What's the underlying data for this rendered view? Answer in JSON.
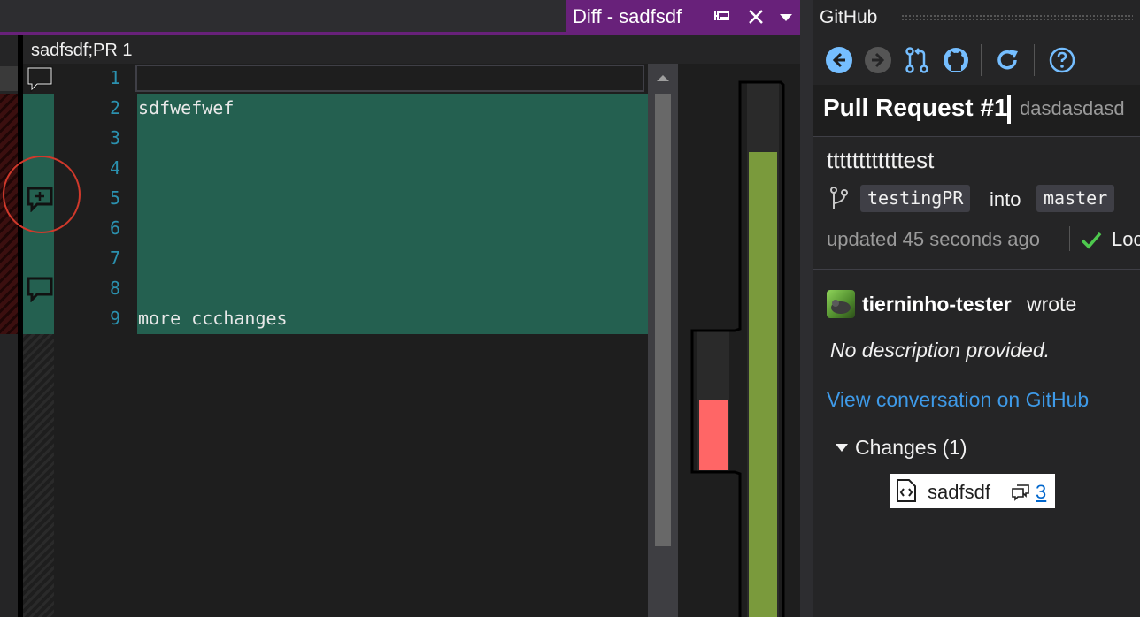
{
  "diff_tab": {
    "title": "Diff - sadfsdf"
  },
  "editor": {
    "file_label": "sadfsdf;PR 1",
    "line_numbers": [
      "1",
      "2",
      "3",
      "4",
      "5",
      "6",
      "7",
      "8",
      "9"
    ],
    "lines": [
      "",
      "sdfwefwef",
      "",
      "",
      "",
      "",
      "",
      "",
      "more ccchanges"
    ]
  },
  "colors": {
    "accent": "#68217a",
    "added_line": "#246050",
    "deleted_overview": "#ff6666",
    "added_overview": "#7a9a3c",
    "link": "#3e9ae8"
  },
  "github_panel": {
    "title": "GitHub",
    "toolbar_icons": [
      "back-icon",
      "forward-icon",
      "pull-request-icon",
      "github-icon",
      "refresh-icon",
      "help-icon"
    ],
    "pr_title": "Pull Request #1",
    "repo": "dasdasdasd",
    "pr_name": "ttttttttttttest",
    "source_branch": "testingPR",
    "into_label": "into",
    "target_branch": "master",
    "updated": "updated 45 seconds ago",
    "status": "Loc",
    "author": "tierninho-tester",
    "wrote_label": "wrote",
    "description": "No description provided.",
    "view_link": "View conversation on GitHub",
    "changes_label": "Changes (1)",
    "file_name": "sadfsdf",
    "comment_count": "3"
  }
}
